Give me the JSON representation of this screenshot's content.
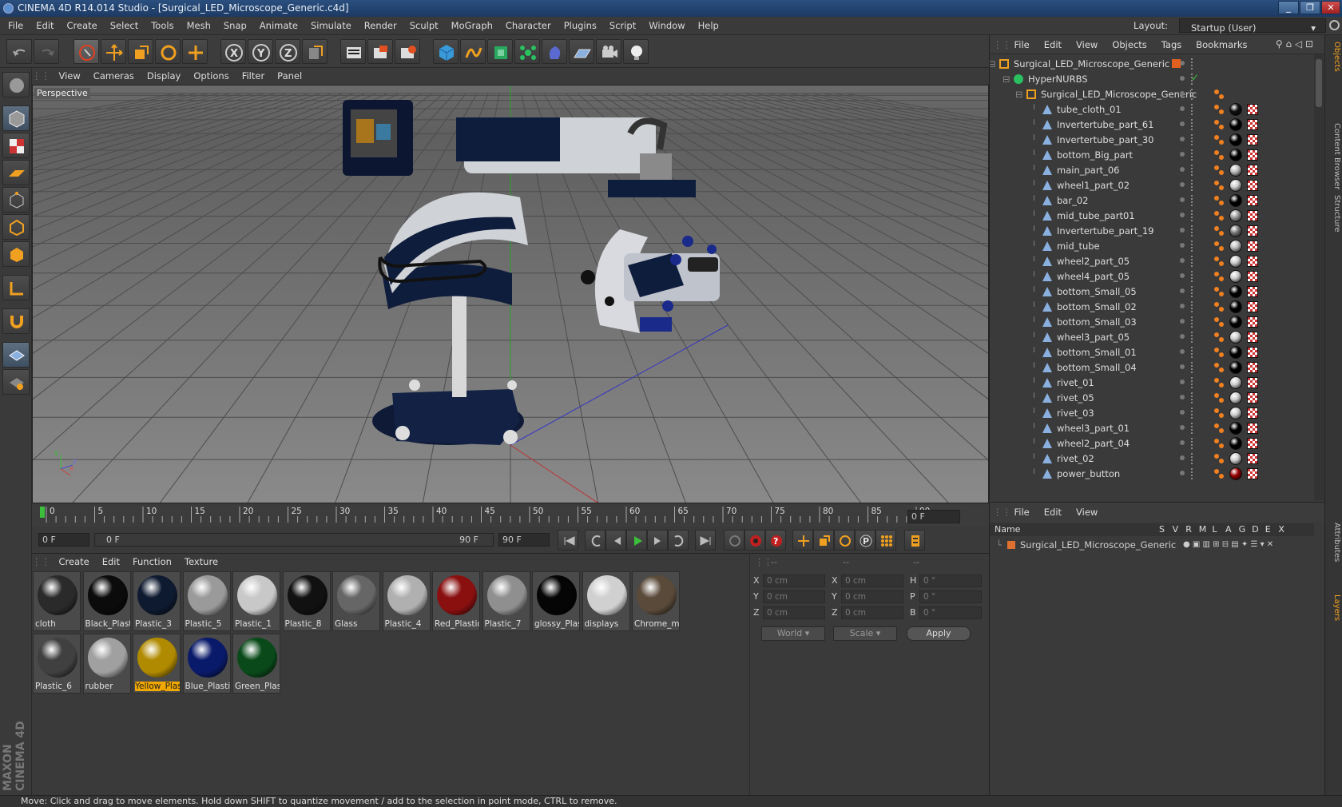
{
  "window": {
    "title": "CINEMA 4D R14.014 Studio - [Surgical_LED_Microscope_Generic.c4d]",
    "controls": [
      "_",
      "❐",
      "✕"
    ]
  },
  "menubar": {
    "items": [
      "File",
      "Edit",
      "Create",
      "Select",
      "Tools",
      "Mesh",
      "Snap",
      "Animate",
      "Simulate",
      "Render",
      "Sculpt",
      "MoGraph",
      "Character",
      "Plugins",
      "Script",
      "Window",
      "Help"
    ],
    "layout_label": "Layout:",
    "layout_value": "Startup (User)"
  },
  "viewport": {
    "menu": [
      "View",
      "Cameras",
      "Display",
      "Options",
      "Filter",
      "Panel"
    ],
    "label": "Perspective",
    "axis": {
      "x": "x",
      "y": "y",
      "z": "z"
    }
  },
  "timeline": {
    "ticks": [
      "0",
      "5",
      "10",
      "15",
      "20",
      "25",
      "30",
      "35",
      "40",
      "45",
      "50",
      "55",
      "60",
      "65",
      "70",
      "75",
      "80",
      "85",
      "90"
    ],
    "current_frame": "0 F"
  },
  "transport": {
    "start": "0 F",
    "slider_left": "0 F",
    "slider_right": "90 F",
    "end": "90 F"
  },
  "materials": {
    "menu": [
      "Create",
      "Edit",
      "Function",
      "Texture"
    ],
    "items": [
      {
        "name": "cloth",
        "color": "#2a2a2a"
      },
      {
        "name": "Black_Plast",
        "color": "#0b0b0b"
      },
      {
        "name": "Plastic_3",
        "color": "#0e1a30"
      },
      {
        "name": "Plastic_5",
        "color": "#9a9a9a"
      },
      {
        "name": "Plastic_1",
        "color": "#c8c8c8"
      },
      {
        "name": "Plastic_8",
        "color": "#111111"
      },
      {
        "name": "Glass",
        "color": "#666666"
      },
      {
        "name": "Plastic_4",
        "color": "#b0b0b0"
      },
      {
        "name": "Red_Plastic",
        "color": "#8a1010"
      },
      {
        "name": "Plastic_7",
        "color": "#8f8f8f"
      },
      {
        "name": "glossy_Plas",
        "color": "#050505"
      },
      {
        "name": "displays",
        "color": "#d0d0d0"
      },
      {
        "name": "Chrome_m",
        "color": "#5a4a3a"
      },
      {
        "name": "Plastic_6",
        "color": "#404040"
      },
      {
        "name": "rubber",
        "color": "#a0a0a0"
      },
      {
        "name": "Yellow_Plas",
        "color": "#b08a00"
      },
      {
        "name": "Blue_Plasti",
        "color": "#0a1a6a"
      },
      {
        "name": "Green_Plas",
        "color": "#0a4a1a"
      }
    ]
  },
  "coords": {
    "headers": [
      "--",
      "--",
      "--"
    ],
    "rows": [
      {
        "a": "X",
        "av": "0 cm",
        "b": "X",
        "bv": "0 cm",
        "c": "H",
        "cv": "0 °"
      },
      {
        "a": "Y",
        "av": "0 cm",
        "b": "Y",
        "bv": "0 cm",
        "c": "P",
        "cv": "0 °"
      },
      {
        "a": "Z",
        "av": "0 cm",
        "b": "Z",
        "bv": "0 cm",
        "c": "B",
        "cv": "0 °"
      }
    ],
    "mode1": "World",
    "mode2": "Scale",
    "apply": "Apply"
  },
  "objects": {
    "menu": [
      "File",
      "Edit",
      "View",
      "Objects",
      "Tags",
      "Bookmarks"
    ],
    "root": "Surgical_LED_Microscope_Generic",
    "hypernurbs": "HyperNURBS",
    "group": "Surgical_LED_Microscope_Generic",
    "children": [
      {
        "name": "tube_cloth_01",
        "mat": "#111"
      },
      {
        "name": "Invertertube_part_61",
        "mat": "#000"
      },
      {
        "name": "Invertertube_part_30",
        "mat": "#000"
      },
      {
        "name": "bottom_Big_part",
        "mat": "#000"
      },
      {
        "name": "main_part_06",
        "mat": "#bbb"
      },
      {
        "name": "wheel1_part_02",
        "mat": "#ccc"
      },
      {
        "name": "bar_02",
        "mat": "#000"
      },
      {
        "name": "mid_tube_part01",
        "mat": "#999"
      },
      {
        "name": "Invertertube_part_19",
        "mat": "#777"
      },
      {
        "name": "mid_tube",
        "mat": "#bbb"
      },
      {
        "name": "wheel2_part_05",
        "mat": "#ccc"
      },
      {
        "name": "wheel4_part_05",
        "mat": "#ccc"
      },
      {
        "name": "bottom_Small_05",
        "mat": "#000"
      },
      {
        "name": "bottom_Small_02",
        "mat": "#000"
      },
      {
        "name": "bottom_Small_03",
        "mat": "#000"
      },
      {
        "name": "wheel3_part_05",
        "mat": "#ccc"
      },
      {
        "name": "bottom_Small_01",
        "mat": "#000"
      },
      {
        "name": "bottom_Small_04",
        "mat": "#000"
      },
      {
        "name": "rivet_01",
        "mat": "#ccc"
      },
      {
        "name": "rivet_05",
        "mat": "#ccc"
      },
      {
        "name": "rivet_03",
        "mat": "#ccc"
      },
      {
        "name": "wheel3_part_01",
        "mat": "#000"
      },
      {
        "name": "wheel2_part_04",
        "mat": "#000"
      },
      {
        "name": "rivet_02",
        "mat": "#ccc"
      },
      {
        "name": "power_button",
        "mat": "#900"
      }
    ]
  },
  "layers": {
    "menu": [
      "File",
      "Edit",
      "View"
    ],
    "columns": [
      "Name",
      "S",
      "V",
      "R",
      "M",
      "L",
      "A",
      "G",
      "D",
      "E",
      "X"
    ],
    "row": "Surgical_LED_Microscope_Generic"
  },
  "sidetabs": [
    "Objects",
    "Content Browser",
    "Structure",
    "Attributes",
    "Layers"
  ],
  "brand": "MAXON CINEMA 4D",
  "status": "Move: Click and drag to move elements. Hold down SHIFT to quantize movement / add to the selection in point mode, CTRL to remove."
}
